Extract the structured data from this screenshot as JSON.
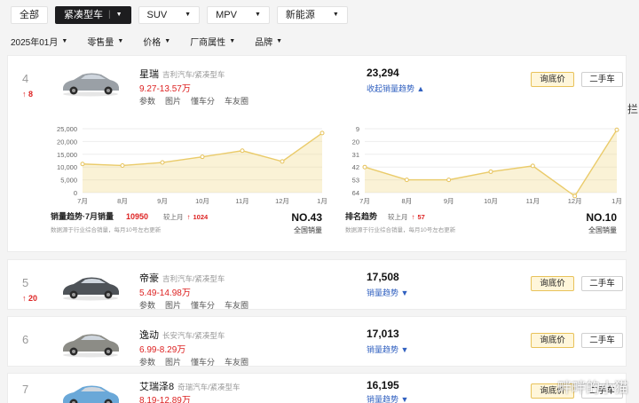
{
  "tabs": [
    {
      "label": "全部"
    },
    {
      "label": "紧凑型车",
      "active": true
    },
    {
      "label": "SUV"
    },
    {
      "label": "MPV"
    },
    {
      "label": "新能源"
    }
  ],
  "filters": [
    {
      "label": "2025年01月"
    },
    {
      "label": "零售量"
    },
    {
      "label": "价格"
    },
    {
      "label": "厂商属性"
    },
    {
      "label": "品牌"
    }
  ],
  "rows": [
    {
      "rank": "4",
      "rank_change": "8",
      "name": "星瑞",
      "maker": "吉利汽车/紧凑型车",
      "price": "9.27-13.57万",
      "links": [
        "参数",
        "图片",
        "懂车分",
        "车友圈"
      ],
      "sales": "23,294",
      "trend_label": "收起销量趋势",
      "trend_arrow": "▲",
      "btn_price": "询底价",
      "btn_used": "二手车",
      "car_color": "#9aa0a6"
    },
    {
      "rank": "5",
      "rank_change": "20",
      "name": "帝豪",
      "maker": "吉利汽车/紧凑型车",
      "price": "5.49-14.98万",
      "links": [
        "参数",
        "图片",
        "懂车分",
        "车友圈"
      ],
      "sales": "17,508",
      "trend_label": "销量趋势",
      "trend_arrow": "▼",
      "btn_price": "询底价",
      "btn_used": "二手车",
      "car_color": "#4e5358"
    },
    {
      "rank": "6",
      "rank_change": "",
      "name": "逸动",
      "maker": "长安汽车/紧凑型车",
      "price": "6.99-8.29万",
      "links": [
        "参数",
        "图片",
        "懂车分",
        "车友圈"
      ],
      "sales": "17,013",
      "trend_label": "销量趋势",
      "trend_arrow": "▼",
      "btn_price": "询底价",
      "btn_used": "二手车",
      "car_color": "#8c8c86"
    },
    {
      "rank": "7",
      "rank_change": "",
      "name": "艾瑞泽8",
      "maker": "奇瑞汽车/紧凑型车",
      "price": "8.19-12.89万",
      "links": [],
      "sales": "16,195",
      "trend_label": "销量趋势",
      "trend_arrow": "▼",
      "btn_price": "询底价",
      "btn_used": "二手车",
      "car_color": "#6aa8d8"
    }
  ],
  "chart_data": [
    {
      "type": "area",
      "categories": [
        "7月",
        "8月",
        "9月",
        "10月",
        "11月",
        "12月",
        "1月"
      ],
      "values": [
        11200,
        10600,
        11800,
        14000,
        16400,
        12200,
        23294
      ],
      "ylim": [
        0,
        25000
      ],
      "yticks": [
        "25,000",
        "20,000",
        "15,000",
        "10,000",
        "5,000",
        "0"
      ],
      "ytick_values": [
        25000,
        20000,
        15000,
        10000,
        5000,
        0
      ],
      "grid": true,
      "color": "#f2d98a",
      "footer": {
        "title": "销量趋势·7月销量",
        "value": "10950",
        "compare_label": "较上月",
        "compare_arrow": "↑",
        "compare_value": "1024",
        "note": "数据源于行业综合销量，每月10号左右更新",
        "rank": "NO.43",
        "rank_label": "全国销量"
      }
    },
    {
      "type": "area",
      "categories": [
        "7月",
        "8月",
        "9月",
        "10月",
        "11月",
        "12月",
        "1月"
      ],
      "values": [
        42,
        53,
        53,
        46,
        41,
        67,
        10
      ],
      "ylim": [
        9,
        64
      ],
      "inverted": true,
      "yticks": [
        "9",
        "20",
        "31",
        "42",
        "53",
        "64"
      ],
      "ytick_values": [
        9,
        20,
        31,
        42,
        53,
        64
      ],
      "grid": true,
      "color": "#f2d98a",
      "footer": {
        "title": "排名趋势",
        "value": "",
        "compare_label": "较上月",
        "compare_arrow": "↑",
        "compare_value": "57",
        "note": "数据源于行业综合销量，每月10号左右更新",
        "rank": "NO.10",
        "rank_label": "全国销量"
      }
    }
  ],
  "side_mark": "拦",
  "watermark": "畔畔的小猫"
}
